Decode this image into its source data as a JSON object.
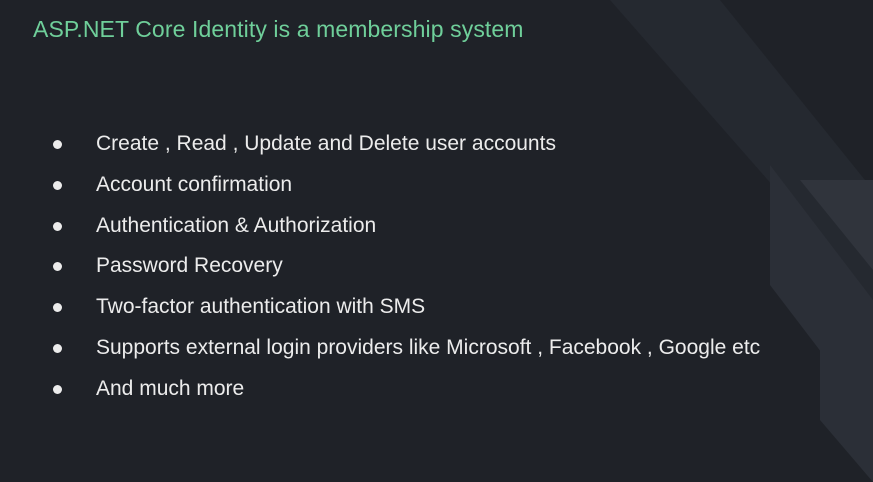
{
  "slide": {
    "title": "ASP.NET Core Identity is a membership system",
    "bullets": [
      "Create , Read , Update and Delete user accounts",
      "Account confirmation",
      "Authentication & Authorization",
      "Password Recovery",
      "Two-factor authentication with SMS",
      "Supports external login providers like Microsoft , Facebook , Google etc",
      "And much more"
    ]
  },
  "colors": {
    "background": "#1f2228",
    "title": "#6fcf9a",
    "text": "#ececec",
    "decoration": "#2a2e35"
  }
}
